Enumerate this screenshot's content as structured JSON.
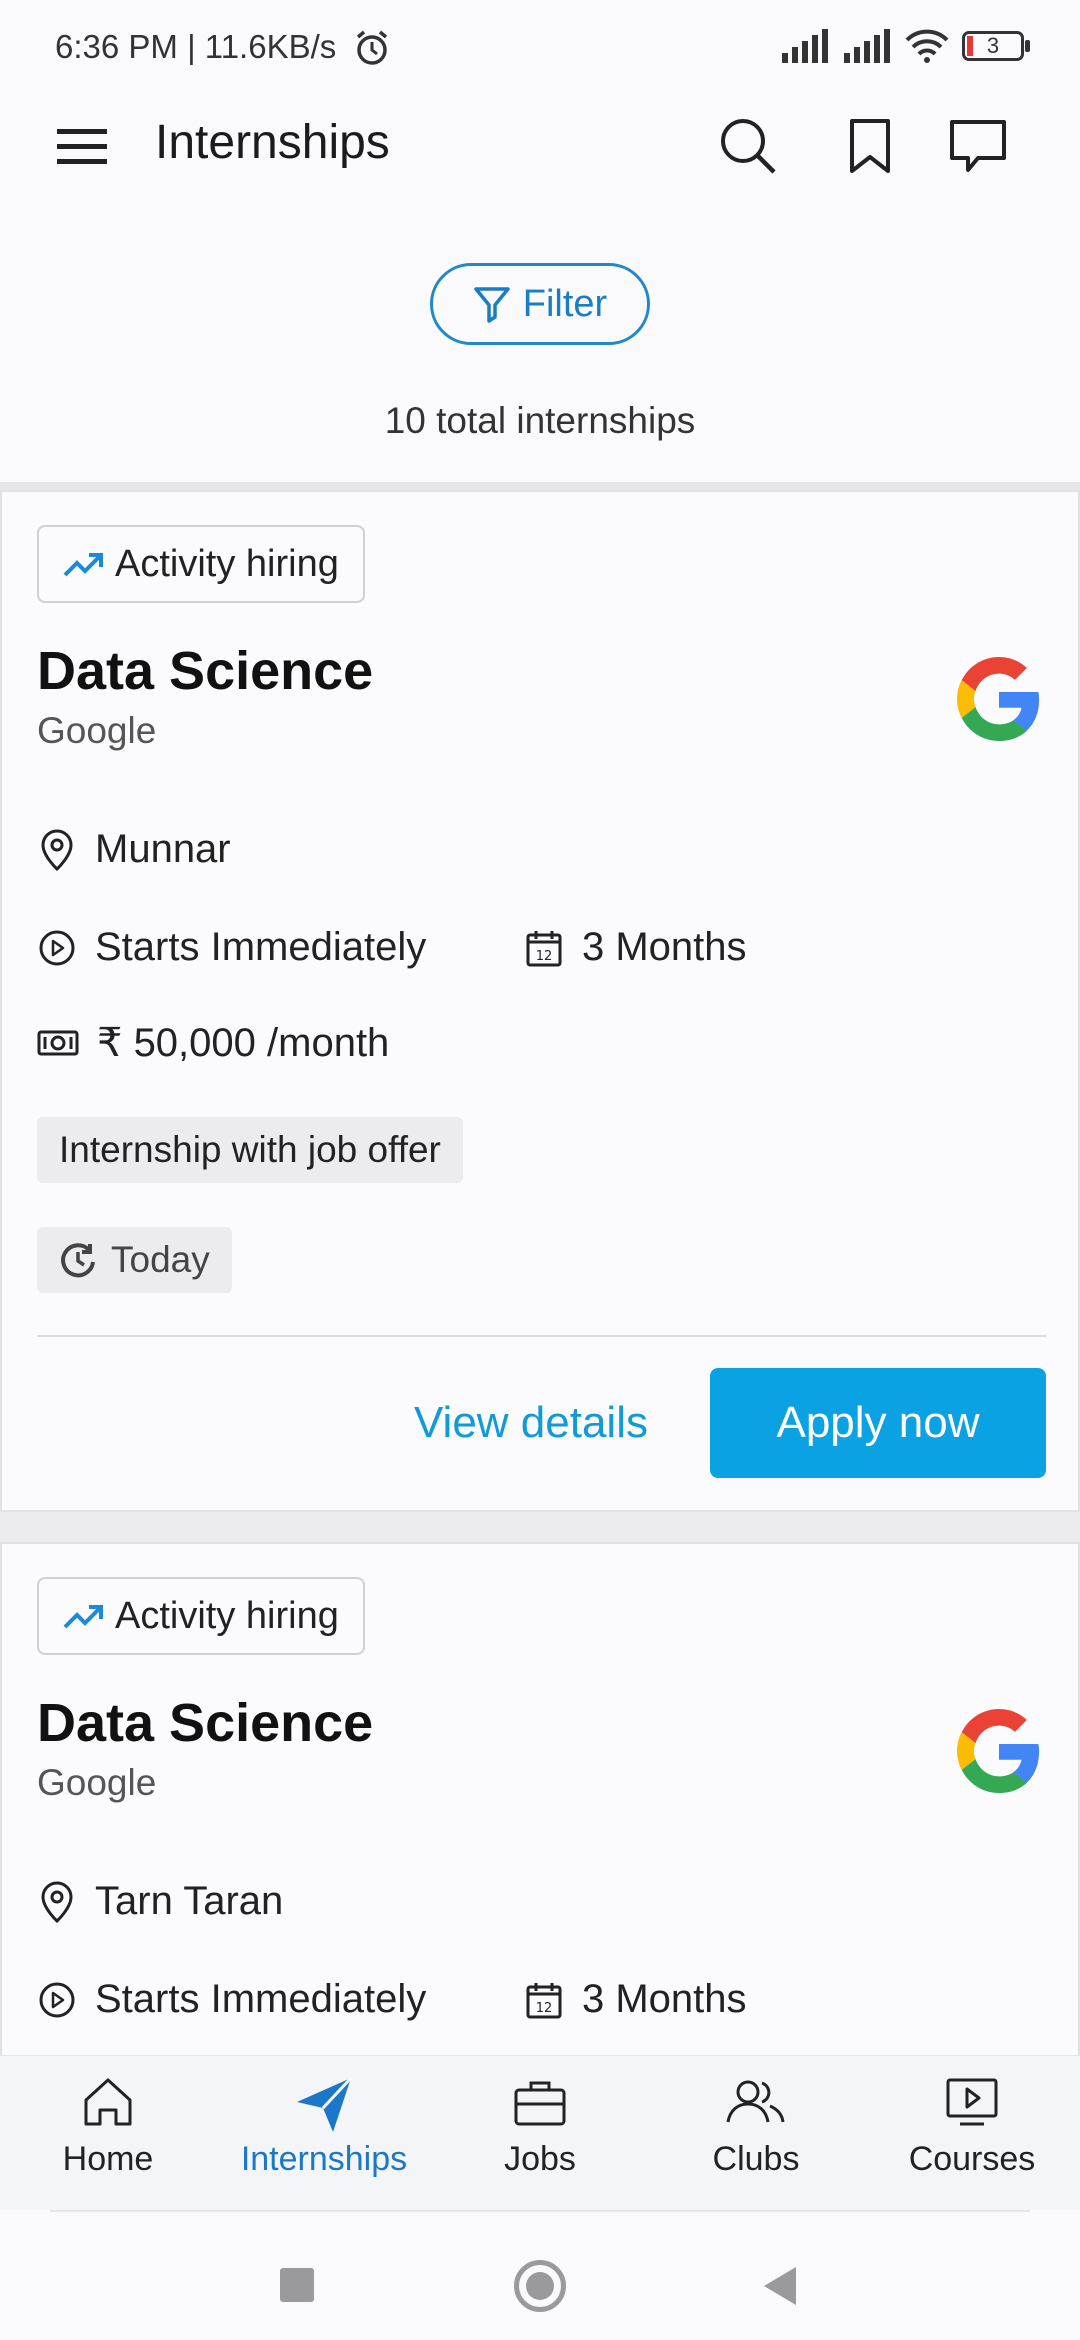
{
  "status_bar": {
    "time": "6:36 PM | 11.6KB/s",
    "battery": "3"
  },
  "app_bar": {
    "title": "Internships"
  },
  "filter": {
    "label": "Filter"
  },
  "summary": {
    "total_text": "10 total internships"
  },
  "cards": [
    {
      "badge": "Activity hiring",
      "title": "Data Science",
      "company": "Google",
      "location": "Munnar",
      "start": "Starts Immediately",
      "duration": "3 Months",
      "stipend": "₹ 50,000 /month",
      "tag": "Internship with job offer",
      "posted": "Today",
      "view_label": "View details",
      "apply_label": "Apply now"
    },
    {
      "badge": "Activity hiring",
      "title": "Data Science",
      "company": "Google",
      "location": "Tarn Taran",
      "start": "Starts Immediately",
      "duration": "3 Months"
    }
  ],
  "bottom_nav": {
    "items": [
      {
        "label": "Home",
        "icon": "home-icon"
      },
      {
        "label": "Internships",
        "icon": "paper-plane-icon",
        "active": true
      },
      {
        "label": "Jobs",
        "icon": "briefcase-icon"
      },
      {
        "label": "Clubs",
        "icon": "people-icon"
      },
      {
        "label": "Courses",
        "icon": "play-screen-icon"
      }
    ]
  },
  "colors": {
    "accent": "#0aa2e3",
    "accent_text": "#119ad8",
    "active_nav": "#1b78c8"
  }
}
